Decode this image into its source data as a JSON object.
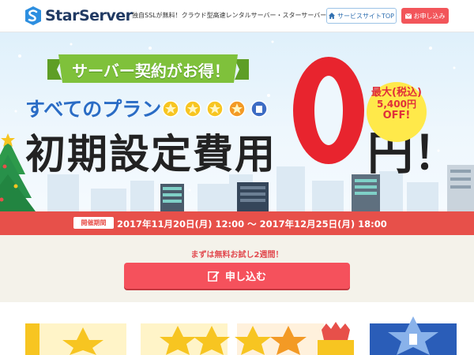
{
  "header": {
    "logo_text": "StarServer",
    "tagline": "独自SSLが無料！クラウド型高速レンタルサーバー・スターサーバー",
    "site_top_label": "サービスサイトTOP",
    "apply_label": "お申し込み"
  },
  "hero": {
    "ribbon_text": "サーバー契約がお得！",
    "plan_text": "すべてのプラン",
    "headline": "初期設定費用",
    "zero": "0",
    "yen": "円！",
    "badge": {
      "line1": "最大(税込)",
      "line2": "5,400円",
      "line3": "OFF!"
    }
  },
  "period": {
    "label": "開催期間",
    "text": "2017年11月20日(月) 12:00 ～ 2017年12月25日(月) 18:00"
  },
  "cta": {
    "note": "まずは無料お試し2週間！",
    "button_label": "申し込む"
  },
  "colors": {
    "brand_blue": "#213a63",
    "accent_red": "#f2555a",
    "ribbon_green": "#7fc13b",
    "plan_blue": "#2a6cc5",
    "badge_yellow": "#ffe94a"
  },
  "icons": {
    "site_top": "home-icon",
    "apply_top": "mail-icon",
    "cta": "edit-icon"
  }
}
